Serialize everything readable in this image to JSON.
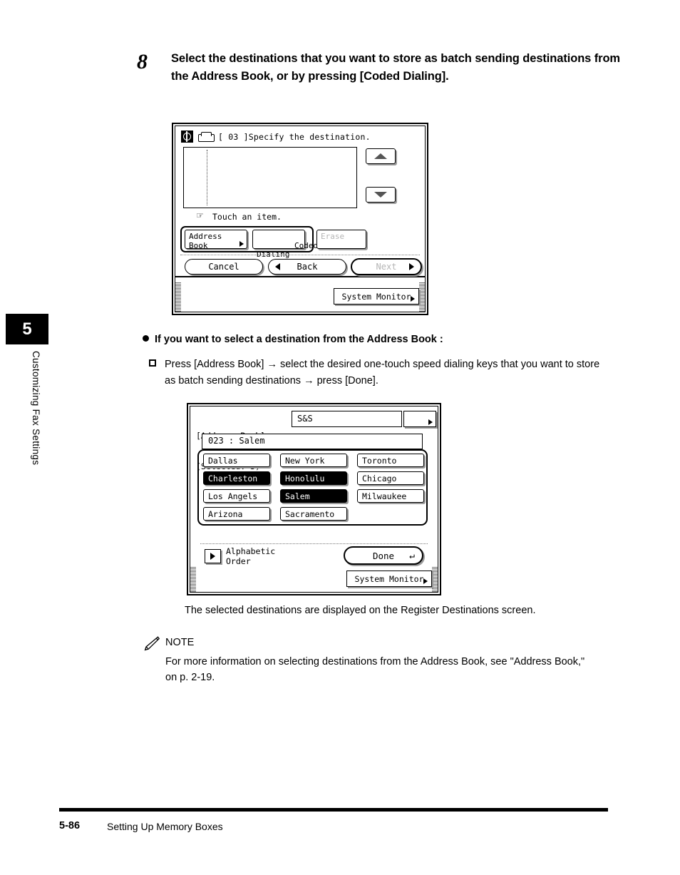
{
  "sidebar": {
    "chapter_number": "5",
    "chapter_title": "Customizing Fax Settings"
  },
  "step": {
    "number": "8",
    "text": "Select the destinations that you want to store as batch sending destinations from the Address Book, or by pressing [Coded Dialing]."
  },
  "panel1": {
    "title": "[ 03 ]Specify the destination.",
    "mode_icon": "fax-mode-icon",
    "device_icon": "fax-machine-icon",
    "scroll_up": "scroll-up-arrow",
    "scroll_down": "scroll-down-arrow",
    "touch_hint": "Touch an item.",
    "hand_icon": "pointing-hand-icon",
    "keys": [
      {
        "label": "Address Book",
        "state": "enabled",
        "has_arrow": true
      },
      {
        "label": "Coded\nDialing",
        "state": "enabled",
        "has_arrow": false
      },
      {
        "label": "Erase",
        "state": "disabled",
        "has_arrow": false
      }
    ],
    "nav": {
      "cancel": "Cancel",
      "back": "Back",
      "next": "Next"
    },
    "system_monitor": "System Monitor"
  },
  "panel2": {
    "header_line1": "[Address Book]",
    "header_line2": "(Selected: 3)",
    "filter_value": "S&S",
    "readout": "023 : Salem",
    "entries": [
      {
        "label": "Dallas",
        "selected": false
      },
      {
        "label": "New York",
        "selected": false
      },
      {
        "label": "Toronto",
        "selected": false
      },
      {
        "label": "Charleston",
        "selected": true
      },
      {
        "label": "Honolulu",
        "selected": true
      },
      {
        "label": "Chicago",
        "selected": false
      },
      {
        "label": "Los Angels",
        "selected": false
      },
      {
        "label": "Salem",
        "selected": true
      },
      {
        "label": "Milwaukee",
        "selected": false
      },
      {
        "label": "Arizona",
        "selected": false
      },
      {
        "label": "Sacramento",
        "selected": false
      }
    ],
    "alphabetic_order": "Alphabetic\nOrder",
    "done": "Done",
    "system_monitor": "System Monitor"
  },
  "bullet": {
    "heading": "If you want to select a destination from the Address Book :",
    "item": "Press [Address Book] → select the desired one-touch speed dialing keys that you want to store as batch sending destinations → press [Done]."
  },
  "caption": "The selected destinations are displayed on the Register Destinations screen.",
  "note": {
    "label": "NOTE",
    "icon": "pencil-icon",
    "body": "For more information on selecting destinations from the Address Book, see \"Address Book,\" on p. 2-19."
  },
  "footer": {
    "page_number": "5-86",
    "section_title": "Setting Up Memory Boxes"
  }
}
